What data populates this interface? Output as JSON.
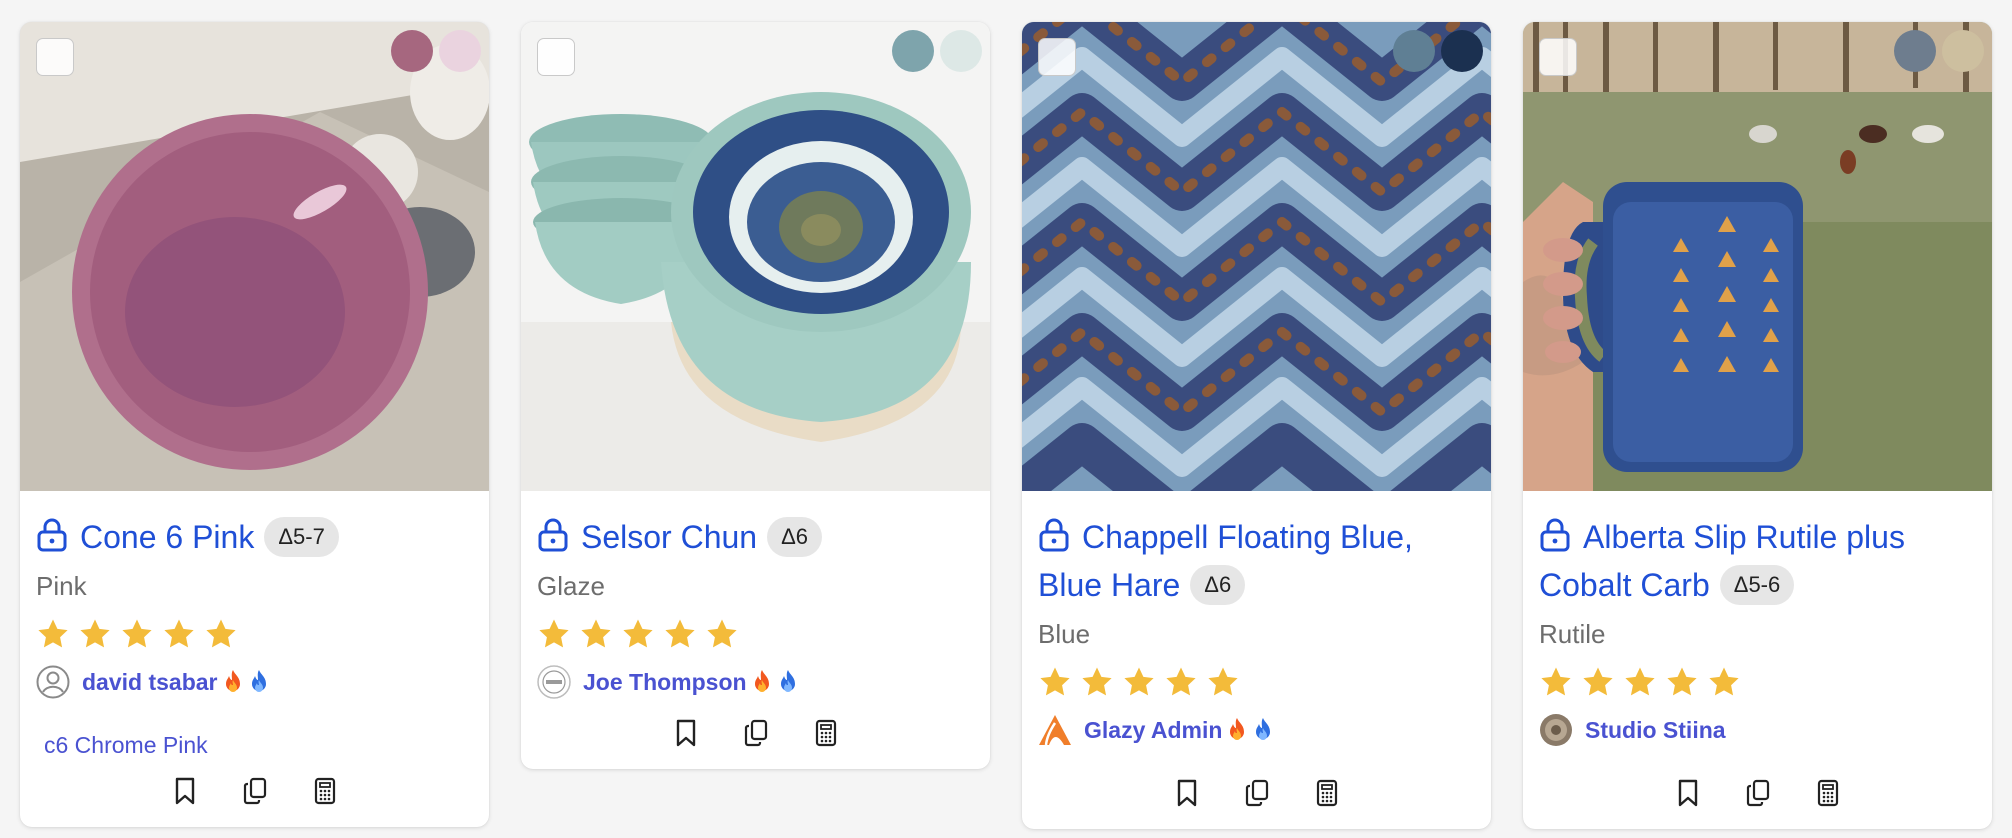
{
  "cards": [
    {
      "title": "Cone 6 Pink",
      "cone": "Δ5-7",
      "category": "Pink",
      "rating": 5,
      "author": "david tsabar",
      "related_link": "c6 Chrome Pink",
      "swatches": [
        "#a6677f",
        "#ead3df"
      ]
    },
    {
      "title": "Selsor Chun",
      "cone": "Δ6",
      "category": "Glaze",
      "rating": 5,
      "author": "Joe Thompson",
      "swatches": [
        "#7ea4ac",
        "#dde8e6"
      ]
    },
    {
      "title": "Chappell Floating Blue, Blue Hare",
      "cone": "Δ6",
      "category": "Blue",
      "rating": 5,
      "author": "Glazy Admin",
      "swatches": [
        "#5f7f94",
        "#1b3050"
      ]
    },
    {
      "title": "Alberta Slip Rutile plus Cobalt Carb",
      "cone": "Δ5-6",
      "category": "Rutile",
      "rating": 5,
      "author": "Studio Stiina",
      "swatches": [
        "#6e7d8e",
        "#cdbf9f"
      ]
    }
  ],
  "colors": {
    "link": "#1f4fd6",
    "author": "#4a52d1",
    "star": "#f3bb3a"
  },
  "icons": [
    "lock-icon",
    "star-icon",
    "fire-icon",
    "drop-icon",
    "bookmark-icon",
    "copy-icon",
    "calculator-icon"
  ]
}
